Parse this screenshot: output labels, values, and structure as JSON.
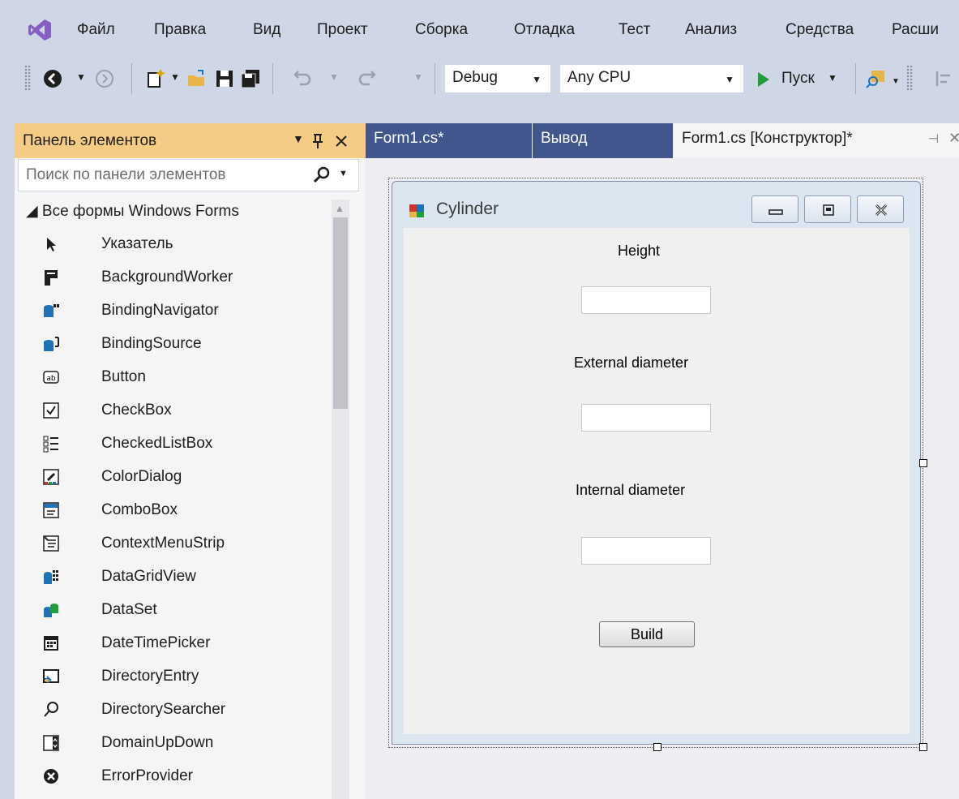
{
  "menu": {
    "items": [
      "Файл",
      "Правка",
      "Вид",
      "Проект",
      "Сборка",
      "Отладка",
      "Тест",
      "Анализ",
      "Средства",
      "Расши"
    ]
  },
  "toolbar": {
    "config": "Debug",
    "platform": "Any CPU",
    "start_label": "Пуск"
  },
  "toolbox": {
    "title": "Панель элементов",
    "search_placeholder": "Поиск по панели элементов",
    "group": "◢ Все формы Windows Forms",
    "items": [
      {
        "label": "Указатель",
        "icon": "pointer-icon"
      },
      {
        "label": "BackgroundWorker",
        "icon": "backgroundworker-icon"
      },
      {
        "label": "BindingNavigator",
        "icon": "bindingnavigator-icon"
      },
      {
        "label": "BindingSource",
        "icon": "bindingsource-icon"
      },
      {
        "label": "Button",
        "icon": "button-icon"
      },
      {
        "label": "CheckBox",
        "icon": "checkbox-icon"
      },
      {
        "label": "CheckedListBox",
        "icon": "checkedlistbox-icon"
      },
      {
        "label": "ColorDialog",
        "icon": "colordialog-icon"
      },
      {
        "label": "ComboBox",
        "icon": "combobox-icon"
      },
      {
        "label": "ContextMenuStrip",
        "icon": "contextmenustrip-icon"
      },
      {
        "label": "DataGridView",
        "icon": "datagridview-icon"
      },
      {
        "label": "DataSet",
        "icon": "dataset-icon"
      },
      {
        "label": "DateTimePicker",
        "icon": "datetimepicker-icon"
      },
      {
        "label": "DirectoryEntry",
        "icon": "directoryentry-icon"
      },
      {
        "label": "DirectorySearcher",
        "icon": "directorysearcher-icon"
      },
      {
        "label": "DomainUpDown",
        "icon": "domainupdown-icon"
      },
      {
        "label": "ErrorProvider",
        "icon": "errorprovider-icon"
      }
    ]
  },
  "tabs": [
    {
      "label": "Form1.cs*"
    },
    {
      "label": "Вывод"
    },
    {
      "label": "Form1.cs [Конструктор]*"
    }
  ],
  "form": {
    "title": "Cylinder",
    "height_label": "Height",
    "external_label": "External diameter",
    "internal_label": "Internal diameter",
    "build_label": "Build"
  },
  "colors": {
    "accent": "#865fc5",
    "toolbox_header": "#f5cc84",
    "tab_active": "#f5f5f5",
    "tab_inactive": "#40568d",
    "play": "#1e9e3c"
  }
}
